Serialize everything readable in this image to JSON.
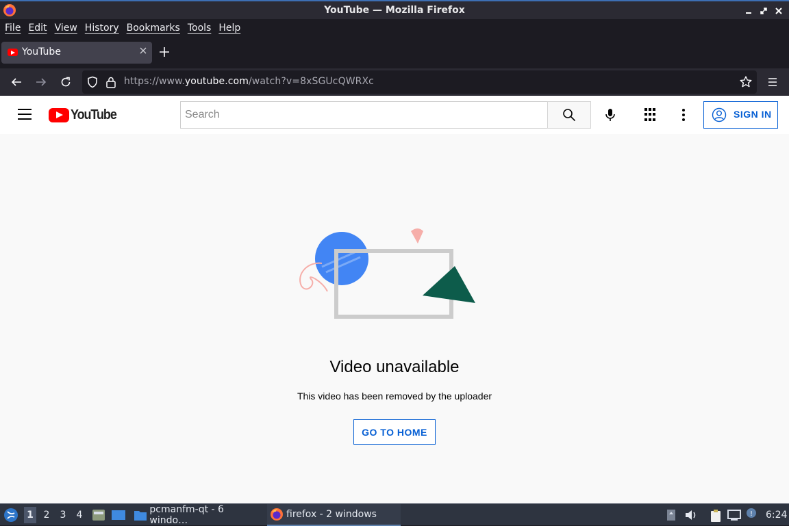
{
  "window": {
    "title": "YouTube — Mozilla Firefox"
  },
  "menubar": {
    "items": [
      "File",
      "Edit",
      "View",
      "History",
      "Bookmarks",
      "Tools",
      "Help"
    ]
  },
  "tabs": [
    {
      "label": "YouTube",
      "active": true
    }
  ],
  "navbar": {
    "url_prefix": "https://www.",
    "url_domain": "youtube.com",
    "url_path": "/watch?v=8xSGUcQWRXc"
  },
  "youtube": {
    "logo_text": "YouTube",
    "search_placeholder": "Search",
    "sign_in_label": "SIGN IN",
    "error_title": "Video unavailable",
    "error_subtitle": "This video has been removed by the uploader",
    "go_home_label": "GO TO HOME",
    "colors": {
      "brand_red": "#ff0000",
      "link_blue": "#065fd4"
    }
  },
  "taskbar": {
    "workspaces": [
      "1",
      "2",
      "3",
      "4"
    ],
    "active_workspace": "1",
    "tasks": [
      {
        "label": "pcmanfm-qt - 6 windo…",
        "icon": "folder-icon"
      },
      {
        "label": "firefox - 2 windows",
        "icon": "firefox-icon",
        "active": true
      }
    ],
    "clock": "6:24"
  }
}
